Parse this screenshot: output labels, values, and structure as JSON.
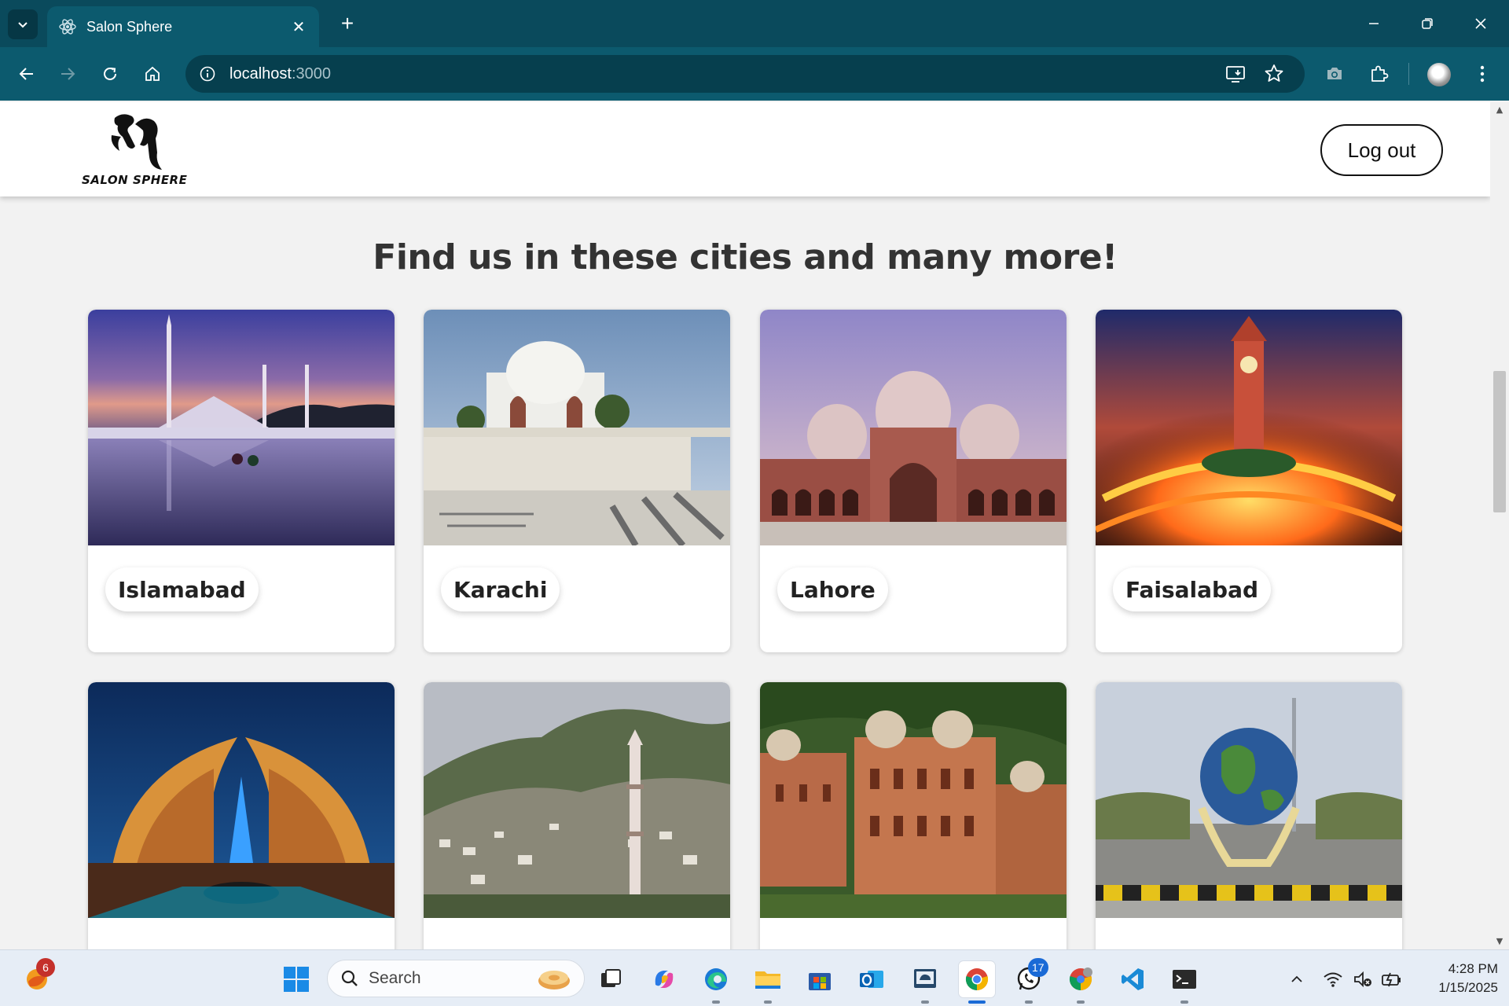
{
  "browser": {
    "tab_title": "Salon Sphere",
    "tab_close": "✕",
    "new_tab": "+",
    "url_host": "localhost",
    "url_port": ":3000"
  },
  "site": {
    "logo_text": "SALON SPHERE",
    "logout_label": "Log out",
    "headline": "Find us in these cities and many more!"
  },
  "cities": [
    {
      "name": "Islamabad",
      "photo": "faisal-mosque-icon"
    },
    {
      "name": "Karachi",
      "photo": "mazar-e-quaid-icon"
    },
    {
      "name": "Lahore",
      "photo": "badshahi-mosque-icon"
    },
    {
      "name": "Faisalabad",
      "photo": "clock-tower-icon"
    },
    {
      "name": "",
      "photo": "pakistan-monument-icon"
    },
    {
      "name": "",
      "photo": "hill-town-minaret-icon"
    },
    {
      "name": "",
      "photo": "heritage-building-icon"
    },
    {
      "name": "",
      "photo": "globe-roundabout-icon"
    }
  ],
  "taskbar": {
    "search_placeholder": "Search",
    "widget_badge": "6",
    "whatsapp_badge": "17",
    "time": "4:28 PM",
    "date": "1/15/2025"
  },
  "colors": {
    "chrome_dark": "#0a4a5c",
    "chrome_toolbar": "#0c5a6e",
    "page_bg": "#f2f2f2",
    "headline": "#333333"
  }
}
